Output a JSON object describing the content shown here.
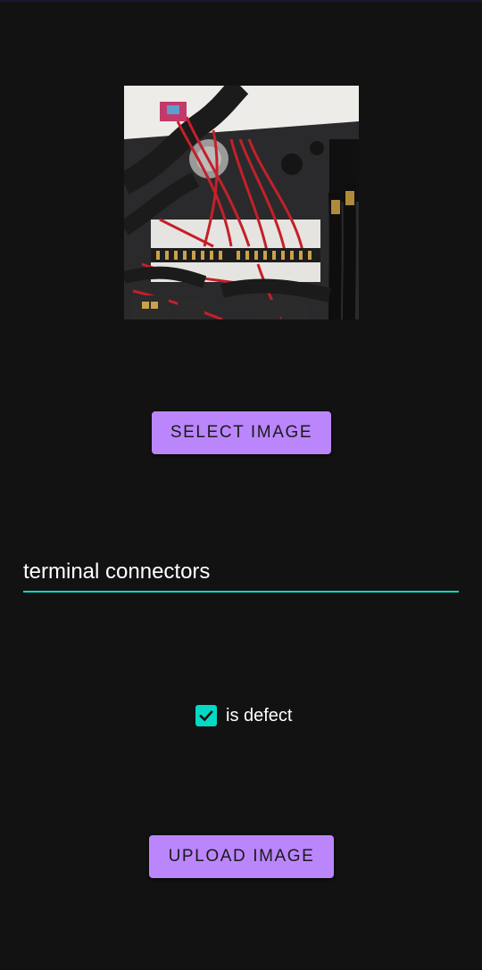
{
  "preview_image": {
    "alt": "",
    "icon": "photo-of-wiring-panel"
  },
  "select_button": {
    "label": "SELECT IMAGE"
  },
  "description_field": {
    "value": "terminal connectors"
  },
  "defect_checkbox": {
    "label": "is defect",
    "checked": true
  },
  "upload_button": {
    "label": "UPLOAD IMAGE"
  },
  "colors": {
    "background": "#121212",
    "primary": "#bb86fc",
    "secondary": "#03dac5",
    "text": "#ffffff"
  }
}
